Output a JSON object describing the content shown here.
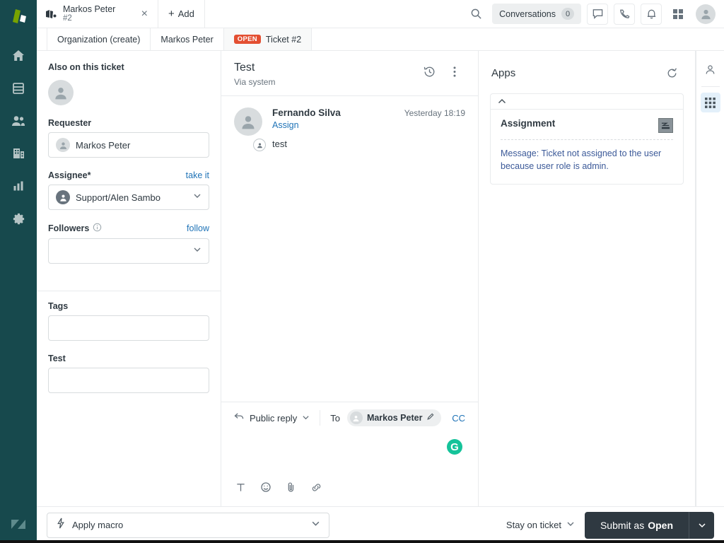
{
  "brand": {
    "accent_blue": "#1F73B7",
    "nav_bg": "#17494D",
    "logo_green": "#78A300",
    "status_open": "#E34F32",
    "submit_bg": "#2F3941",
    "grammarly_green": "#15C39A"
  },
  "nav": {
    "logo_name": "zendesk-logo",
    "items": [
      {
        "name": "home-icon",
        "label": "Home"
      },
      {
        "name": "views-icon",
        "label": "Views"
      },
      {
        "name": "customers-icon",
        "label": "Customers"
      },
      {
        "name": "organizations-icon",
        "label": "Organizations"
      },
      {
        "name": "reporting-icon",
        "label": "Reporting"
      },
      {
        "name": "admin-gear-icon",
        "label": "Admin"
      }
    ],
    "bottom_logo_name": "zendesk-mark"
  },
  "topbar": {
    "tab": {
      "title": "Markos Peter",
      "subtitle": "#2",
      "close_label": "×"
    },
    "add_label": "Add",
    "add_plus": "+",
    "conversations_label": "Conversations",
    "conversations_count": "0",
    "icons": [
      "search-icon",
      "chat-icon",
      "phone-icon",
      "bell-icon",
      "apps-grid-icon",
      "user-avatar"
    ]
  },
  "breadcrumbs": [
    {
      "label": "Organization (create)",
      "badge": "",
      "active": false
    },
    {
      "label": "Markos Peter",
      "badge": "",
      "active": false
    },
    {
      "label": "Ticket #2",
      "badge": "OPEN",
      "active": true
    }
  ],
  "properties": {
    "also_on_ticket_label": "Also on this ticket",
    "requester": {
      "label": "Requester",
      "value": "Markos Peter"
    },
    "assignee": {
      "label": "Assignee*",
      "action": "take it",
      "value": "Support/Alen Sambo"
    },
    "followers": {
      "label": "Followers",
      "action": "follow",
      "value": ""
    },
    "tags": {
      "label": "Tags",
      "value": ""
    },
    "test": {
      "label": "Test",
      "value": ""
    }
  },
  "conversation": {
    "title": "Test",
    "via": "Via system",
    "history_icon": "clock-history-icon",
    "more_icon": "more-vertical-icon",
    "comments": [
      {
        "author": "Fernando Silva",
        "assign_label": "Assign",
        "timestamp": "Yesterday 18:19",
        "text": "test"
      }
    ]
  },
  "composer": {
    "channel": "Public reply",
    "to_label": "To",
    "recipient": "Markos Peter",
    "cc_label": "CC",
    "grammarly_glyph": "G",
    "tools": [
      "text-format-icon",
      "emoji-icon",
      "attachment-icon",
      "link-icon"
    ]
  },
  "apps": {
    "title": "Apps",
    "refresh_icon": "refresh-icon",
    "collapse_icon": "chevron-up-icon",
    "cards": [
      {
        "title": "Assignment",
        "icon_name": "assignment-app-icon",
        "message": "Message: Ticket not assigned to the user because user role is admin."
      }
    ]
  },
  "right_rail": [
    {
      "name": "user-profile-icon",
      "active": false
    },
    {
      "name": "apps-grid-icon",
      "active": true
    }
  ],
  "footer": {
    "macro_placeholder": "Apply macro",
    "macro_icon": "lightning-icon",
    "stay_on_ticket": "Stay on ticket",
    "submit_prefix": "Submit as",
    "submit_status": "Open"
  }
}
